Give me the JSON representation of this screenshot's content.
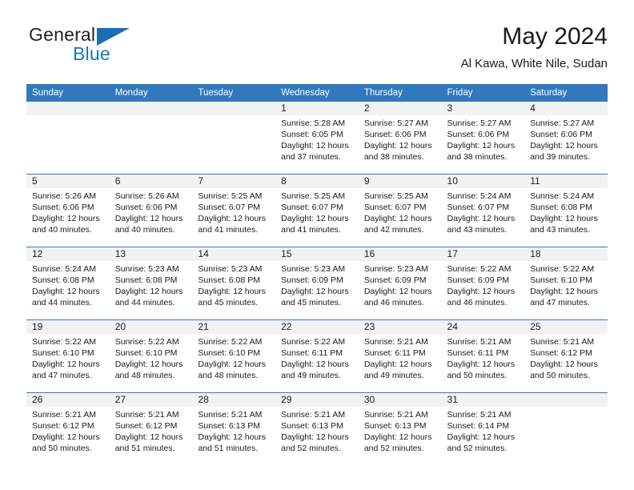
{
  "brand": {
    "word_one": "General",
    "word_two": "Blue",
    "mark": "triangle-logo"
  },
  "header": {
    "title": "May 2024",
    "location": "Al Kawa, White Nile, Sudan"
  },
  "weekday_headers": [
    "Sunday",
    "Monday",
    "Tuesday",
    "Wednesday",
    "Thursday",
    "Friday",
    "Saturday"
  ],
  "colors": {
    "header_blue": "#3179bc",
    "brand_blue": "#1878be",
    "daynum_band": "#f2f2f2",
    "text": "#1a1a1a"
  },
  "weeks": [
    [
      {
        "empty": true
      },
      {
        "empty": true
      },
      {
        "empty": true
      },
      {
        "day": "1",
        "sunrise": "Sunrise: 5:28 AM",
        "sunset": "Sunset: 6:05 PM",
        "daylight1": "Daylight: 12 hours",
        "daylight2": "and 37 minutes."
      },
      {
        "day": "2",
        "sunrise": "Sunrise: 5:27 AM",
        "sunset": "Sunset: 6:06 PM",
        "daylight1": "Daylight: 12 hours",
        "daylight2": "and 38 minutes."
      },
      {
        "day": "3",
        "sunrise": "Sunrise: 5:27 AM",
        "sunset": "Sunset: 6:06 PM",
        "daylight1": "Daylight: 12 hours",
        "daylight2": "and 38 minutes."
      },
      {
        "day": "4",
        "sunrise": "Sunrise: 5:27 AM",
        "sunset": "Sunset: 6:06 PM",
        "daylight1": "Daylight: 12 hours",
        "daylight2": "and 39 minutes."
      }
    ],
    [
      {
        "day": "5",
        "sunrise": "Sunrise: 5:26 AM",
        "sunset": "Sunset: 6:06 PM",
        "daylight1": "Daylight: 12 hours",
        "daylight2": "and 40 minutes."
      },
      {
        "day": "6",
        "sunrise": "Sunrise: 5:26 AM",
        "sunset": "Sunset: 6:06 PM",
        "daylight1": "Daylight: 12 hours",
        "daylight2": "and 40 minutes."
      },
      {
        "day": "7",
        "sunrise": "Sunrise: 5:25 AM",
        "sunset": "Sunset: 6:07 PM",
        "daylight1": "Daylight: 12 hours",
        "daylight2": "and 41 minutes."
      },
      {
        "day": "8",
        "sunrise": "Sunrise: 5:25 AM",
        "sunset": "Sunset: 6:07 PM",
        "daylight1": "Daylight: 12 hours",
        "daylight2": "and 41 minutes."
      },
      {
        "day": "9",
        "sunrise": "Sunrise: 5:25 AM",
        "sunset": "Sunset: 6:07 PM",
        "daylight1": "Daylight: 12 hours",
        "daylight2": "and 42 minutes."
      },
      {
        "day": "10",
        "sunrise": "Sunrise: 5:24 AM",
        "sunset": "Sunset: 6:07 PM",
        "daylight1": "Daylight: 12 hours",
        "daylight2": "and 43 minutes."
      },
      {
        "day": "11",
        "sunrise": "Sunrise: 5:24 AM",
        "sunset": "Sunset: 6:08 PM",
        "daylight1": "Daylight: 12 hours",
        "daylight2": "and 43 minutes."
      }
    ],
    [
      {
        "day": "12",
        "sunrise": "Sunrise: 5:24 AM",
        "sunset": "Sunset: 6:08 PM",
        "daylight1": "Daylight: 12 hours",
        "daylight2": "and 44 minutes."
      },
      {
        "day": "13",
        "sunrise": "Sunrise: 5:23 AM",
        "sunset": "Sunset: 6:08 PM",
        "daylight1": "Daylight: 12 hours",
        "daylight2": "and 44 minutes."
      },
      {
        "day": "14",
        "sunrise": "Sunrise: 5:23 AM",
        "sunset": "Sunset: 6:08 PM",
        "daylight1": "Daylight: 12 hours",
        "daylight2": "and 45 minutes."
      },
      {
        "day": "15",
        "sunrise": "Sunrise: 5:23 AM",
        "sunset": "Sunset: 6:09 PM",
        "daylight1": "Daylight: 12 hours",
        "daylight2": "and 45 minutes."
      },
      {
        "day": "16",
        "sunrise": "Sunrise: 5:23 AM",
        "sunset": "Sunset: 6:09 PM",
        "daylight1": "Daylight: 12 hours",
        "daylight2": "and 46 minutes."
      },
      {
        "day": "17",
        "sunrise": "Sunrise: 5:22 AM",
        "sunset": "Sunset: 6:09 PM",
        "daylight1": "Daylight: 12 hours",
        "daylight2": "and 46 minutes."
      },
      {
        "day": "18",
        "sunrise": "Sunrise: 5:22 AM",
        "sunset": "Sunset: 6:10 PM",
        "daylight1": "Daylight: 12 hours",
        "daylight2": "and 47 minutes."
      }
    ],
    [
      {
        "day": "19",
        "sunrise": "Sunrise: 5:22 AM",
        "sunset": "Sunset: 6:10 PM",
        "daylight1": "Daylight: 12 hours",
        "daylight2": "and 47 minutes."
      },
      {
        "day": "20",
        "sunrise": "Sunrise: 5:22 AM",
        "sunset": "Sunset: 6:10 PM",
        "daylight1": "Daylight: 12 hours",
        "daylight2": "and 48 minutes."
      },
      {
        "day": "21",
        "sunrise": "Sunrise: 5:22 AM",
        "sunset": "Sunset: 6:10 PM",
        "daylight1": "Daylight: 12 hours",
        "daylight2": "and 48 minutes."
      },
      {
        "day": "22",
        "sunrise": "Sunrise: 5:22 AM",
        "sunset": "Sunset: 6:11 PM",
        "daylight1": "Daylight: 12 hours",
        "daylight2": "and 49 minutes."
      },
      {
        "day": "23",
        "sunrise": "Sunrise: 5:21 AM",
        "sunset": "Sunset: 6:11 PM",
        "daylight1": "Daylight: 12 hours",
        "daylight2": "and 49 minutes."
      },
      {
        "day": "24",
        "sunrise": "Sunrise: 5:21 AM",
        "sunset": "Sunset: 6:11 PM",
        "daylight1": "Daylight: 12 hours",
        "daylight2": "and 50 minutes."
      },
      {
        "day": "25",
        "sunrise": "Sunrise: 5:21 AM",
        "sunset": "Sunset: 6:12 PM",
        "daylight1": "Daylight: 12 hours",
        "daylight2": "and 50 minutes."
      }
    ],
    [
      {
        "day": "26",
        "sunrise": "Sunrise: 5:21 AM",
        "sunset": "Sunset: 6:12 PM",
        "daylight1": "Daylight: 12 hours",
        "daylight2": "and 50 minutes."
      },
      {
        "day": "27",
        "sunrise": "Sunrise: 5:21 AM",
        "sunset": "Sunset: 6:12 PM",
        "daylight1": "Daylight: 12 hours",
        "daylight2": "and 51 minutes."
      },
      {
        "day": "28",
        "sunrise": "Sunrise: 5:21 AM",
        "sunset": "Sunset: 6:13 PM",
        "daylight1": "Daylight: 12 hours",
        "daylight2": "and 51 minutes."
      },
      {
        "day": "29",
        "sunrise": "Sunrise: 5:21 AM",
        "sunset": "Sunset: 6:13 PM",
        "daylight1": "Daylight: 12 hours",
        "daylight2": "and 52 minutes."
      },
      {
        "day": "30",
        "sunrise": "Sunrise: 5:21 AM",
        "sunset": "Sunset: 6:13 PM",
        "daylight1": "Daylight: 12 hours",
        "daylight2": "and 52 minutes."
      },
      {
        "day": "31",
        "sunrise": "Sunrise: 5:21 AM",
        "sunset": "Sunset: 6:14 PM",
        "daylight1": "Daylight: 12 hours",
        "daylight2": "and 52 minutes."
      },
      {
        "empty": true
      }
    ]
  ]
}
